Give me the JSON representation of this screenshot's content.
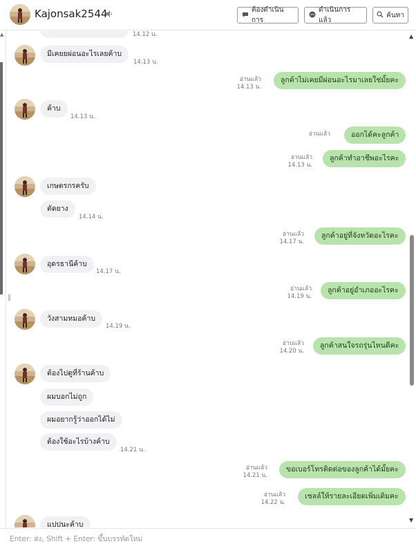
{
  "header": {
    "title": "Kajonsak2544",
    "btn_pending": "ต้องดำเนินการ",
    "btn_done": "ดำเนินการแล้ว",
    "btn_search": "ค้นหา"
  },
  "messages": {
    "t0": "14.12 น.",
    "m1": "มีเคยยผ่อนอะไรเลยค้าบ",
    "t1": "14.13 น.",
    "o1_read": "อ่านแล้ว",
    "o1_time": "14.13 น.",
    "o1": "ลูกค้าไม่เคยมีผ่อนอะไรมาเลยใช่มั้ยคะ",
    "m2": "ค้าบ",
    "t2": "14.13 น.",
    "o2_read": "อ่านแล้ว",
    "o2": "ออกได้คะลูกค้า",
    "o3_read": "อ่านแล้ว",
    "o3_time": "14.13 น.",
    "o3": "ลูกค้าทำอาชีพอะไรคะ",
    "m3": "เกษตรกรครับ",
    "m4": "ตัดยาง",
    "t4": "14.14 น.",
    "o4_read": "อ่านแล้ว",
    "o4_time": "14.17 น.",
    "o4": "ลูกค้าอยู่ที่จังหวัดอะไรคะ",
    "m5": "อุดรธานีค้าบ",
    "t5": "14.17 น.",
    "o5_read": "อ่านแล้ว",
    "o5_time": "14.19 น.",
    "o5": "ลูกค้าอยู่อำเภออะไรคะ",
    "m6": "วังสามหมอค้าบ",
    "t6": "14.19 น.",
    "o6_read": "อ่านแล้ว",
    "o6_time": "14.20 น.",
    "o6": "ลูกค้าสนใจรถรุ่นไหนดีคะ",
    "m7": "ต้องไปดูที่ร้านค้าบ",
    "m8": "ผมบอกไม่ถูก",
    "m9": "ผมอยากรู้ว่าออกได้ไม่",
    "m10": "ต้องใช้อะไรบ้างค้าบ",
    "t10": "14.21 น.",
    "o7_read": "อ่านแล้ว",
    "o7_time": "14.21 น.",
    "o7": "ขอเบอร์โทรติดต่อของลูกค้าได้มั้ยคะ",
    "o8_read": "อ่านแล้ว",
    "o8_time": "14.22 น.",
    "o8": "เชลล์ให้รายละเอียดเพิ่มเติมคะ",
    "m11": "แปปนะค้าบ"
  },
  "footer": {
    "placeholder": "Enter: ส่ง, Shift + Enter: ขึ้นบรรทัดใหม่"
  },
  "colors": {
    "incoming": "#f1f1f3",
    "outgoing": "#b9e3ac"
  }
}
